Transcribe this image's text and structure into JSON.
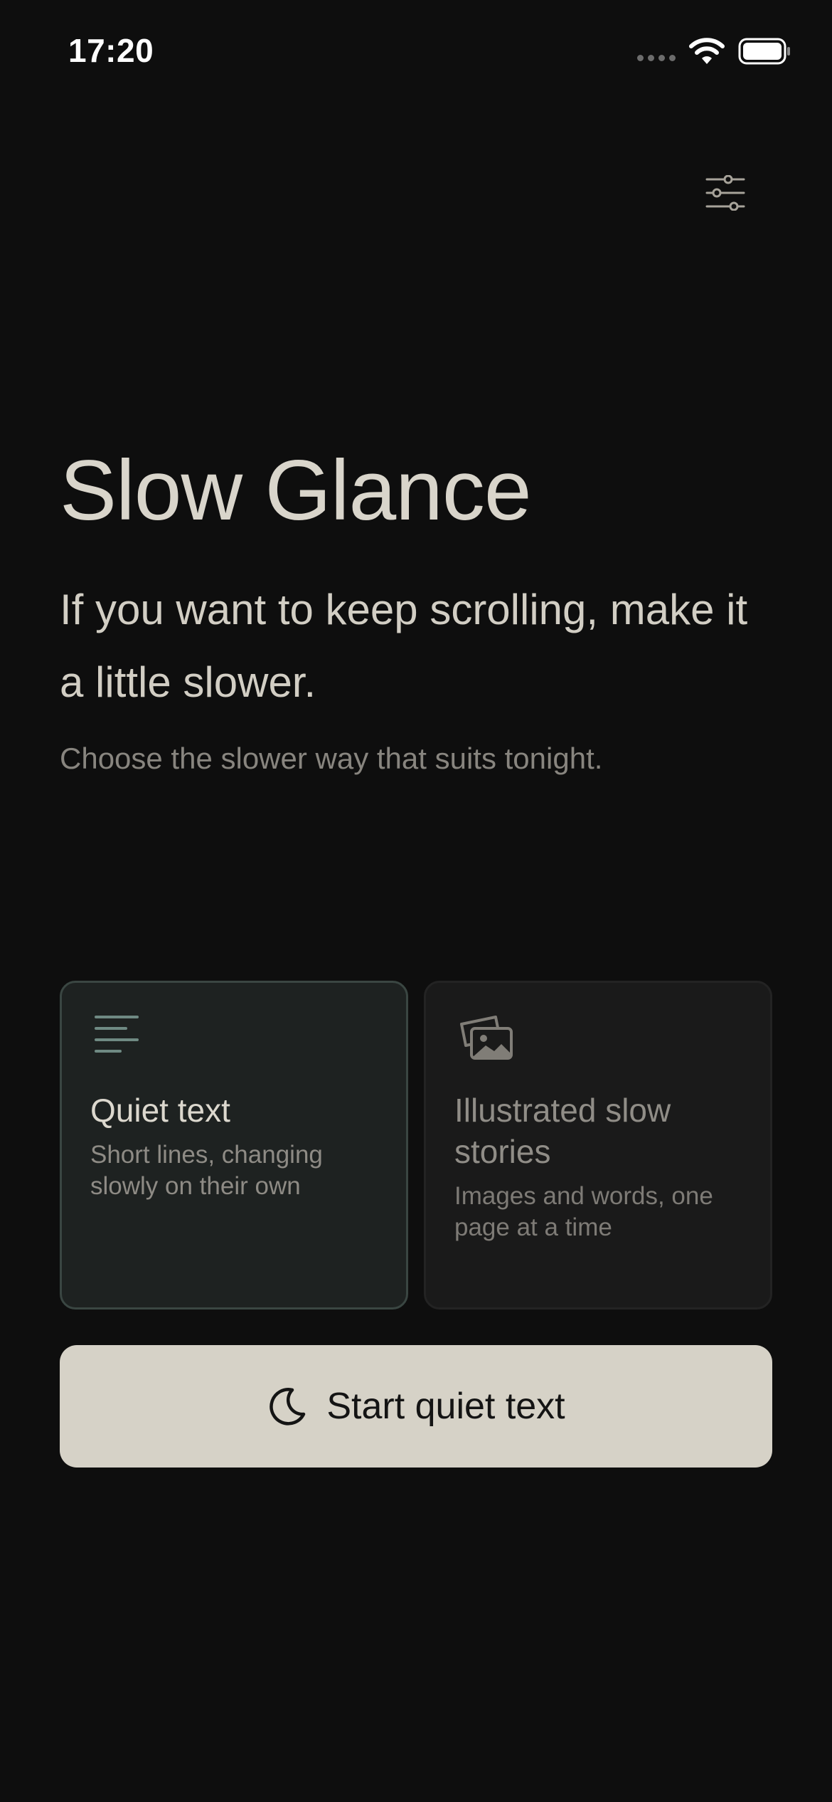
{
  "status_bar": {
    "time": "17:20",
    "icons": [
      "signal-icon",
      "wifi-icon",
      "battery-icon"
    ]
  },
  "header": {
    "settings_icon": "sliders-icon"
  },
  "hero": {
    "title": "Slow Glance",
    "tagline": "If you want to keep scrolling, make it a little slower.",
    "subtitle": "Choose the slower way that suits tonight."
  },
  "options": [
    {
      "icon": "text-lines-icon",
      "title": "Quiet text",
      "description": "Short lines, changing slowly on their own",
      "selected": true
    },
    {
      "icon": "image-stack-icon",
      "title": "Illustrated slow stories",
      "description": "Images and words, one page at a time",
      "selected": false
    }
  ],
  "start_button": {
    "icon": "moon-icon",
    "label": "Start quiet text"
  },
  "colors": {
    "background": "#0e0e0e",
    "title": "#d9d5cb",
    "subtitle": "#88857f",
    "card_selected_bg": "#1e2221",
    "card_selected_border": "#3a4642",
    "card_bg": "#1a1a1a",
    "button_bg": "#d6d2c7",
    "accent_icon": "#6f8a83"
  }
}
